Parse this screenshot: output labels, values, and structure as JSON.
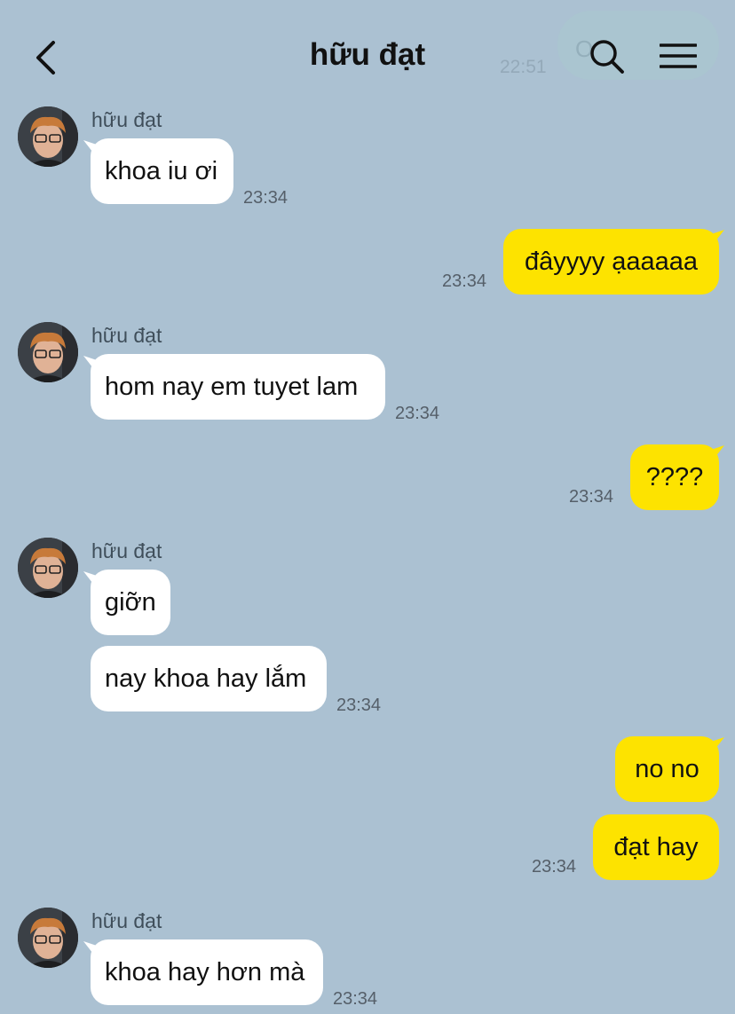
{
  "header": {
    "title": "hữu đạt",
    "ghost_time": "22:51",
    "ghost_text": "O",
    "back_icon": "chevron-left-icon",
    "search_icon": "search-icon",
    "menu_icon": "hamburger-menu-icon"
  },
  "colors": {
    "background": "#abc1d2",
    "incoming_bubble": "#ffffff",
    "outgoing_bubble": "#fde300"
  },
  "messages": [
    {
      "direction": "in",
      "sender": "hữu đạt",
      "text": "khoa iu ơi",
      "time": "23:34"
    },
    {
      "direction": "out",
      "text": "đâyyyy ạaaaaa",
      "time": "23:34"
    },
    {
      "direction": "in",
      "sender": "hữu đạt",
      "text": "hom nay em tuyet lam",
      "time": "23:34"
    },
    {
      "direction": "out",
      "text": "????",
      "time": "23:34"
    },
    {
      "direction": "in",
      "sender": "hữu đạt",
      "text": "giỡn"
    },
    {
      "direction": "in",
      "text": "nay khoa hay lắm",
      "time": "23:34"
    },
    {
      "direction": "out",
      "text": "no no"
    },
    {
      "direction": "out",
      "text": "đạt hay",
      "time": "23:34"
    },
    {
      "direction": "in",
      "sender": "hữu đạt",
      "text": "khoa hay hơn mà",
      "time": "23:34"
    }
  ]
}
